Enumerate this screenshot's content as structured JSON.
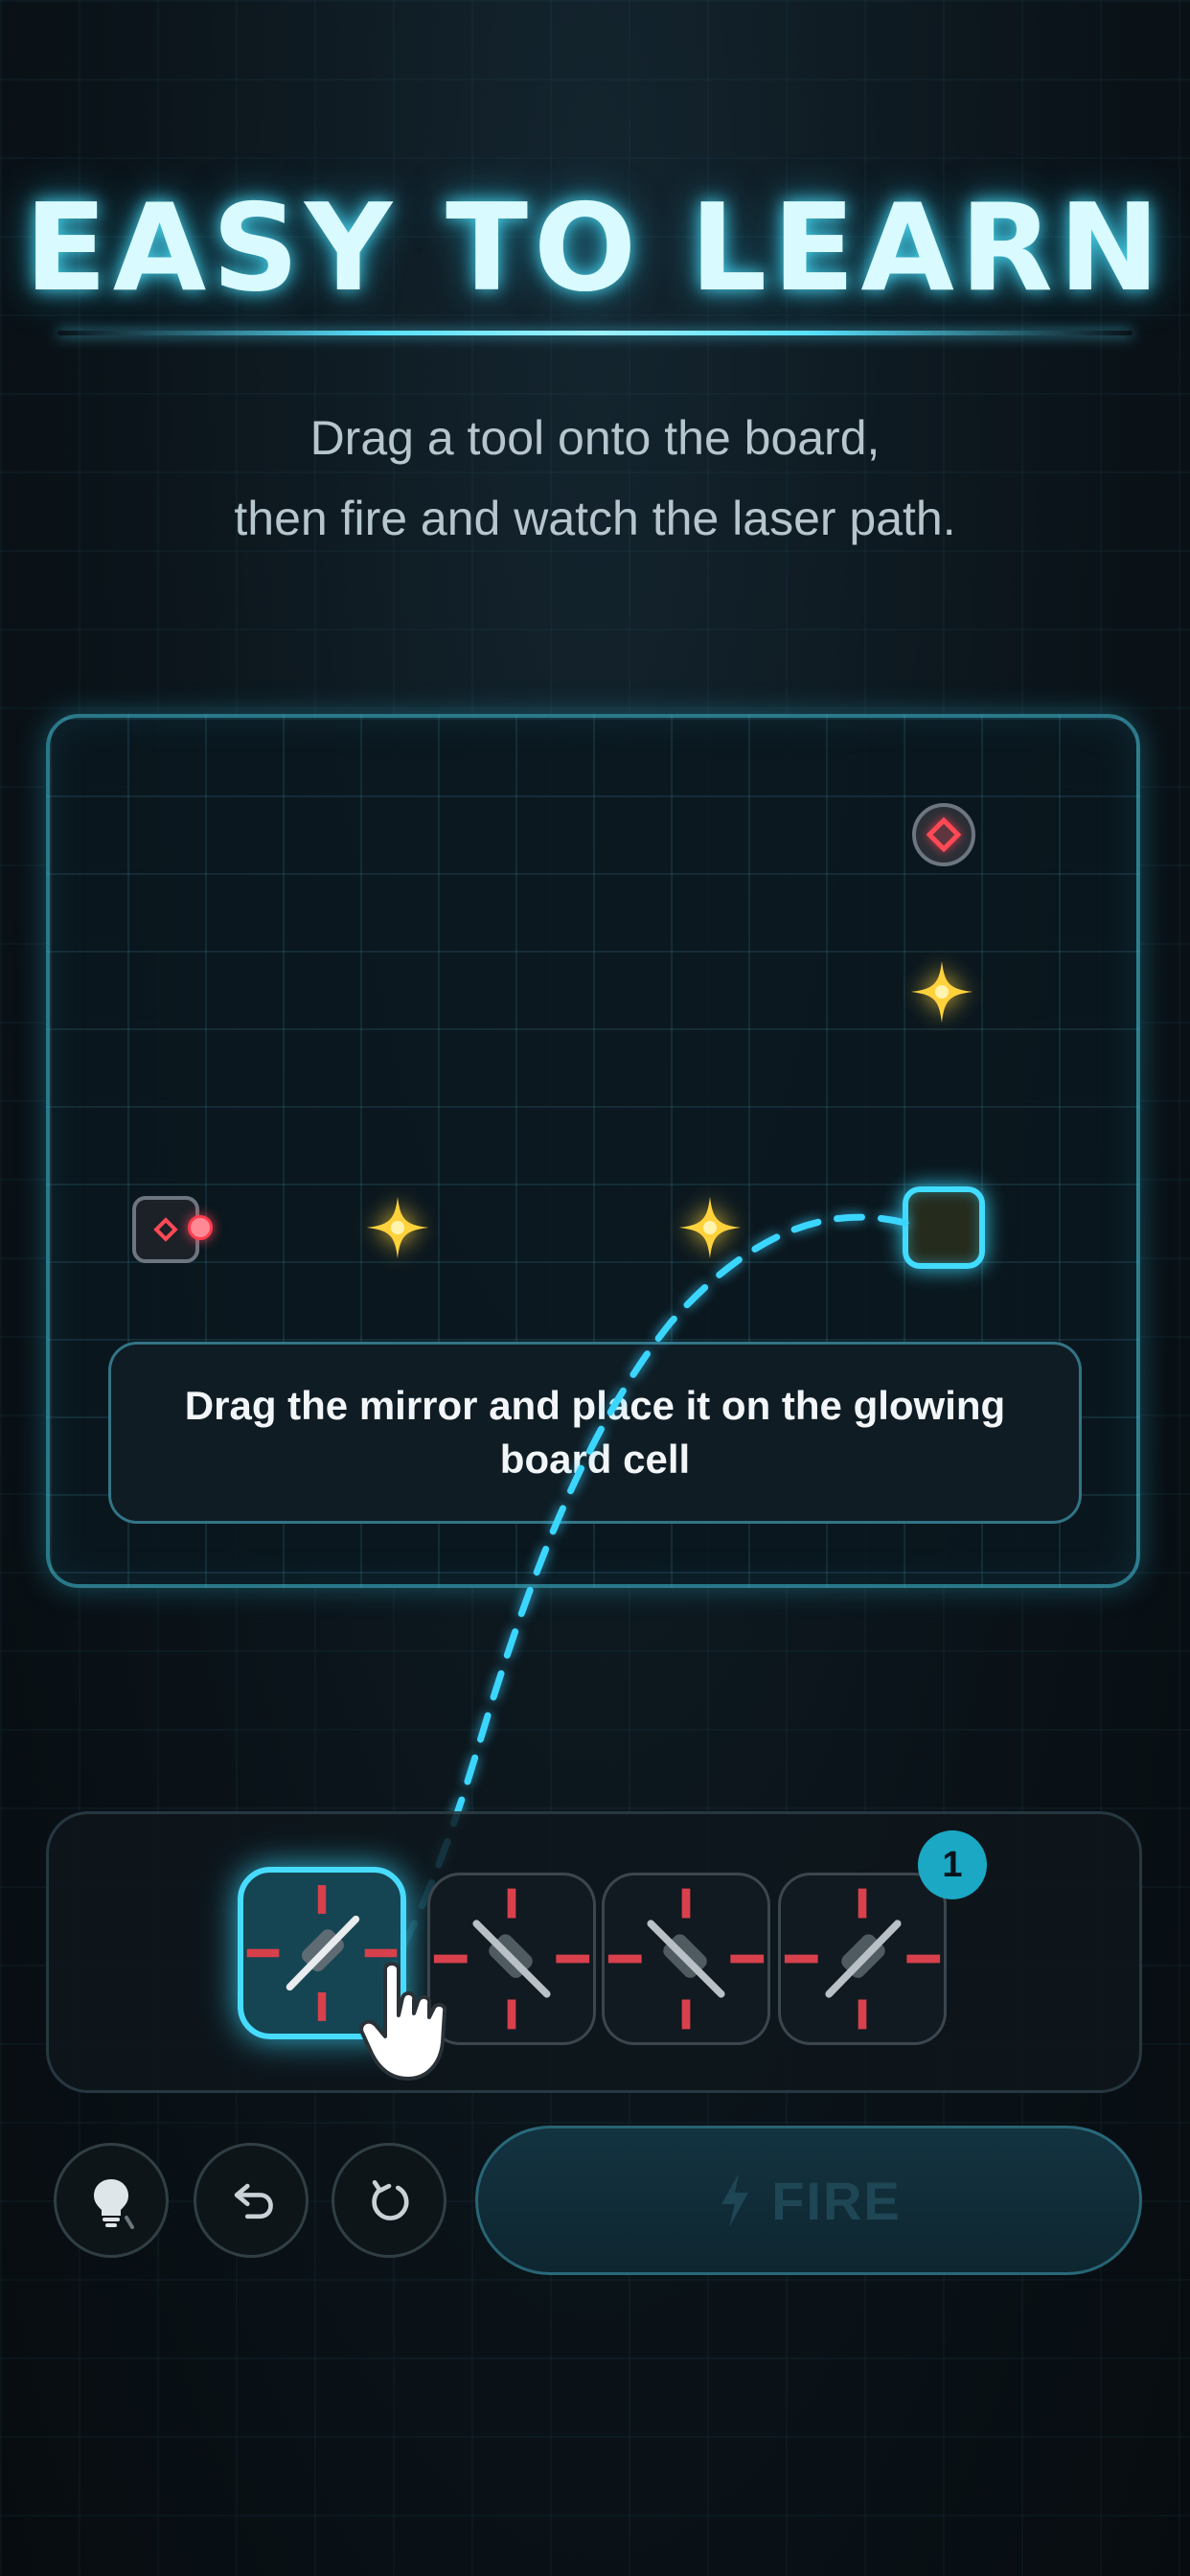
{
  "header": {
    "title": "EASY TO LEARN",
    "subtitle_line1": "Drag a tool onto the board,",
    "subtitle_line2": "then fire and watch the laser path."
  },
  "board": {
    "hint_text": "Drag the mirror and place it on the glowing board cell",
    "pieces": [
      "laser-emitter",
      "target",
      "star",
      "star",
      "star",
      "glowing-cell"
    ]
  },
  "tray": {
    "tools": [
      "mirror-slash",
      "mirror-backslash",
      "mirror-backslash",
      "mirror-slash"
    ],
    "selected_index": 0,
    "badge_count": "1"
  },
  "controls": {
    "hint_icon": "lightbulb-icon",
    "undo_icon": "undo-icon",
    "reset_icon": "reset-icon",
    "fire_label": "FIRE",
    "fire_icon": "lightning-icon"
  },
  "colors": {
    "accent": "#47dcff",
    "laser_red": "#ff4a55",
    "star_gold": "#ffd23c",
    "background": "#0b141a"
  }
}
